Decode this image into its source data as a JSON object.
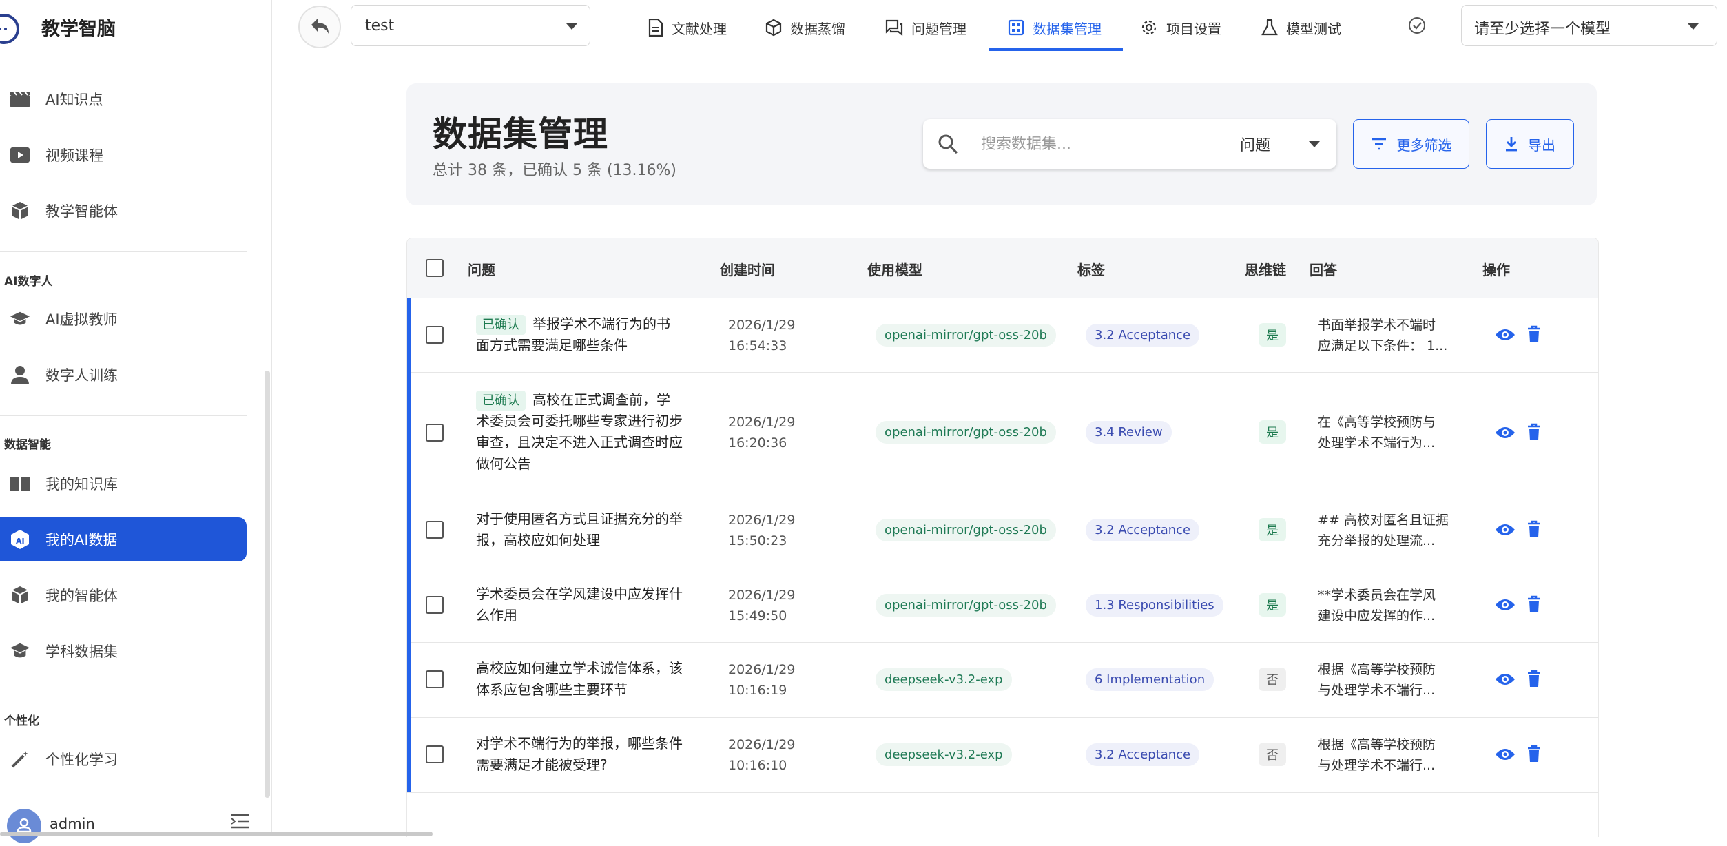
{
  "brand": {
    "name": "教学智脑"
  },
  "sidebar": {
    "items_top": [
      {
        "label": "AI知识点",
        "icon": "clapperboard-icon"
      },
      {
        "label": "视频课程",
        "icon": "video-play-icon"
      },
      {
        "label": "教学智能体",
        "icon": "cube-icon"
      }
    ],
    "sections": [
      {
        "title": "AI数字人",
        "items": [
          {
            "label": "AI虚拟教师",
            "icon": "graduation-cap-icon"
          },
          {
            "label": "数字人训练",
            "icon": "person-icon"
          }
        ]
      },
      {
        "title": "数据智能",
        "items": [
          {
            "label": "我的知识库",
            "icon": "book-icon"
          },
          {
            "label": "我的AI数据",
            "icon": "ai-box-icon",
            "active": true
          },
          {
            "label": "我的智能体",
            "icon": "cube-icon"
          },
          {
            "label": "学科数据集",
            "icon": "graduation-cap-icon"
          }
        ]
      },
      {
        "title": "个性化",
        "items": [
          {
            "label": "个性化学习",
            "icon": "magic-wand-icon"
          }
        ]
      }
    ],
    "user": {
      "name": "admin"
    }
  },
  "topbar": {
    "project_value": "test",
    "tabs": [
      {
        "label": "文献处理",
        "icon": "document-icon"
      },
      {
        "label": "数据蒸馏",
        "icon": "cube-outline-icon"
      },
      {
        "label": "问题管理",
        "icon": "chat-icon"
      },
      {
        "label": "数据集管理",
        "icon": "grid-icon",
        "active": true
      },
      {
        "label": "项目设置",
        "icon": "gear-icon"
      },
      {
        "label": "模型测试",
        "icon": "flask-icon"
      }
    ],
    "model_select": "请至少选择一个模型"
  },
  "header": {
    "title": "数据集管理",
    "subtitle": "总计 38 条，已确认 5 条 (13.16%)",
    "search_placeholder": "搜索数据集...",
    "search_field": "问题",
    "filter_label": "更多筛选",
    "export_label": "导出"
  },
  "table": {
    "columns": [
      "问题",
      "创建时间",
      "使用模型",
      "标签",
      "思维链",
      "回答",
      "操作"
    ],
    "rows": [
      {
        "confirmed": "已确认",
        "question": "举报学术不端行为的书面方式需要满足哪些条件",
        "date": "2026/1/29",
        "time": "16:54:33",
        "model": "openai-mirror/gpt-oss-20b",
        "tag": "3.2 Acceptance",
        "cot": "是",
        "answer1": "书面举报学术不端时",
        "answer2": "应满足以下条件： 1..."
      },
      {
        "confirmed": "已确认",
        "question": "高校在正式调查前，学术委员会可委托哪些专家进行初步审查，且决定不进入正式调查时应做何公告",
        "date": "2026/1/29",
        "time": "16:20:36",
        "model": "openai-mirror/gpt-oss-20b",
        "tag": "3.4 Review",
        "cot": "是",
        "answer1": "在《高等学校预防与",
        "answer2": "处理学术不端行为..."
      },
      {
        "confirmed": "",
        "question": "对于使用匿名方式且证据充分的举报，高校应如何处理",
        "date": "2026/1/29",
        "time": "15:50:23",
        "model": "openai-mirror/gpt-oss-20b",
        "tag": "3.2 Acceptance",
        "cot": "是",
        "answer1": "## 高校对匿名且证据",
        "answer2": "充分举报的处理流..."
      },
      {
        "confirmed": "",
        "question": "学术委员会在学风建设中应发挥什么作用",
        "date": "2026/1/29",
        "time": "15:49:50",
        "model": "openai-mirror/gpt-oss-20b",
        "tag": "1.3 Responsibilities",
        "cot": "是",
        "answer1": "**学术委员会在学风",
        "answer2": "建设中应发挥的作..."
      },
      {
        "confirmed": "",
        "question": "高校应如何建立学术诚信体系，该体系应包含哪些主要环节",
        "date": "2026/1/29",
        "time": "10:16:19",
        "model": "deepseek-v3.2-exp",
        "tag": "6 Implementation",
        "cot": "否",
        "answer1": "根据《高等学校预防",
        "answer2": "与处理学术不端行..."
      },
      {
        "confirmed": "",
        "question": "对学术不端行为的举报，哪些条件需要满足才能被受理?",
        "date": "2026/1/29",
        "time": "10:16:10",
        "model": "deepseek-v3.2-exp",
        "tag": "3.2 Acceptance",
        "cot": "否",
        "answer1": "根据《高等学校预防",
        "answer2": "与处理学术不端行..."
      }
    ]
  },
  "colors": {
    "accent": "#2563eb",
    "active_nav": "#1f56d8"
  }
}
